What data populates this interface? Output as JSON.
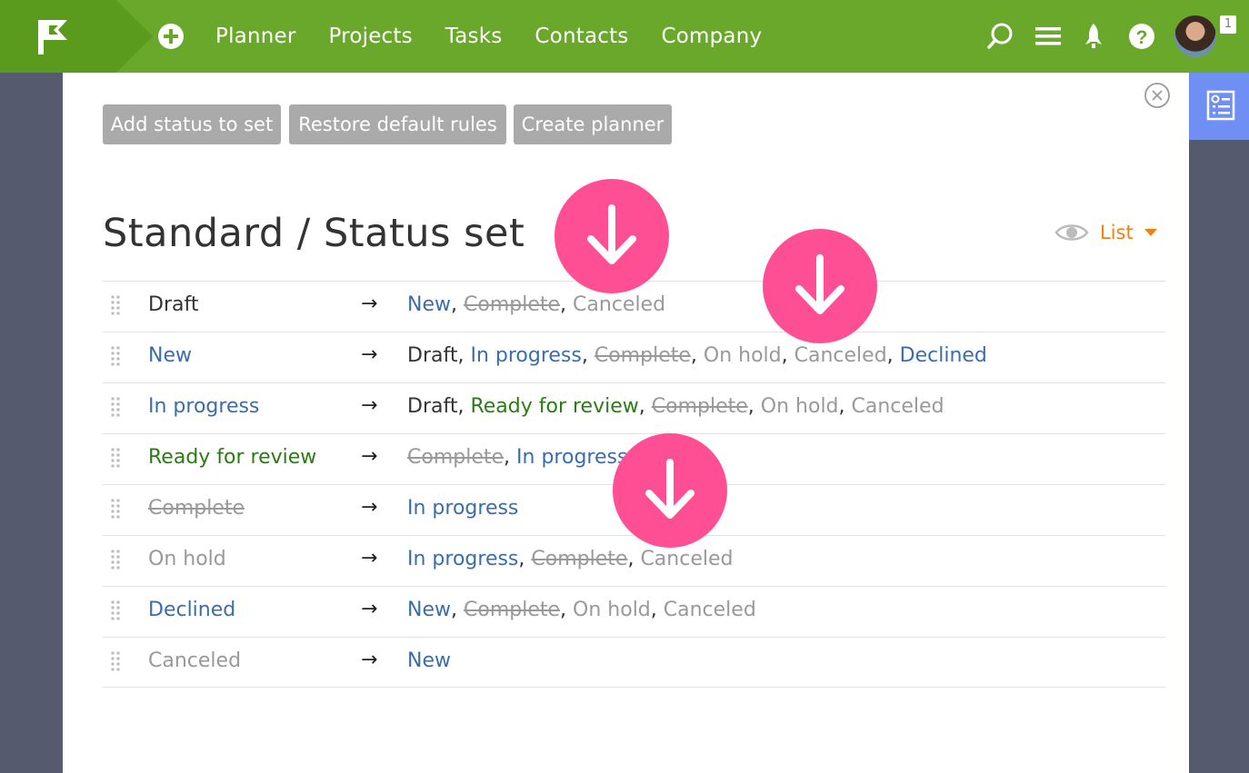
{
  "nav": {
    "items": [
      "Planner",
      "Projects",
      "Tasks",
      "Contacts",
      "Company"
    ],
    "notification_count": "1"
  },
  "toolbar": {
    "add_status": "Add status to set",
    "restore_rules": "Restore default rules",
    "create_planner": "Create planner"
  },
  "page": {
    "title": "Standard / Status set",
    "view_label": "List"
  },
  "colors": {
    "topbar": "#6aa82c",
    "accent_orange": "#f0820f",
    "pink_marker": "#ff4f94",
    "status_blue": "#3b6ea8",
    "status_green": "#2a7d14",
    "status_gray": "#999999"
  },
  "rules": [
    {
      "from": "Draft",
      "from_style": "dark",
      "arrow": "→",
      "targets": [
        {
          "t": "New",
          "s": "blue"
        },
        {
          "t": "Complete",
          "s": "strike"
        },
        {
          "t": "Canceled",
          "s": "gray"
        }
      ]
    },
    {
      "from": "New",
      "from_style": "blue",
      "arrow": "→",
      "targets": [
        {
          "t": "Draft",
          "s": "dark"
        },
        {
          "t": "In progress",
          "s": "blue"
        },
        {
          "t": "Complete",
          "s": "strike"
        },
        {
          "t": "On hold",
          "s": "gray"
        },
        {
          "t": "Canceled",
          "s": "gray"
        },
        {
          "t": "Declined",
          "s": "blue"
        }
      ]
    },
    {
      "from": "In progress",
      "from_style": "blue",
      "arrow": "→",
      "targets": [
        {
          "t": "Draft",
          "s": "dark"
        },
        {
          "t": "Ready for review",
          "s": "green"
        },
        {
          "t": "Complete",
          "s": "strike"
        },
        {
          "t": "On hold",
          "s": "gray"
        },
        {
          "t": "Canceled",
          "s": "gray"
        }
      ]
    },
    {
      "from": "Ready for review",
      "from_style": "green",
      "arrow": "→",
      "targets": [
        {
          "t": "Complete",
          "s": "strike"
        },
        {
          "t": "In progress",
          "s": "blue"
        }
      ]
    },
    {
      "from": "Complete",
      "from_style": "strike",
      "arrow": "→",
      "targets": [
        {
          "t": "In progress",
          "s": "blue"
        }
      ]
    },
    {
      "from": "On hold",
      "from_style": "gray",
      "arrow": "→",
      "targets": [
        {
          "t": "In progress",
          "s": "blue"
        },
        {
          "t": "Complete",
          "s": "strike"
        },
        {
          "t": "Canceled",
          "s": "gray"
        }
      ]
    },
    {
      "from": "Declined",
      "from_style": "blue",
      "arrow": "→",
      "targets": [
        {
          "t": "New",
          "s": "blue"
        },
        {
          "t": "Complete",
          "s": "strike"
        },
        {
          "t": "On hold",
          "s": "gray"
        },
        {
          "t": "Canceled",
          "s": "gray"
        }
      ]
    },
    {
      "from": "Canceled",
      "from_style": "gray",
      "arrow": "→",
      "targets": [
        {
          "t": "New",
          "s": "blue"
        }
      ]
    }
  ],
  "icons": [
    "flag-logo-icon",
    "plus-circle-icon",
    "search-icon",
    "menu-icon",
    "rocket-icon",
    "help-icon",
    "close-circle-icon",
    "settings-list-icon",
    "eye-icon",
    "drag-handle-icon",
    "arrow-down-icon"
  ]
}
